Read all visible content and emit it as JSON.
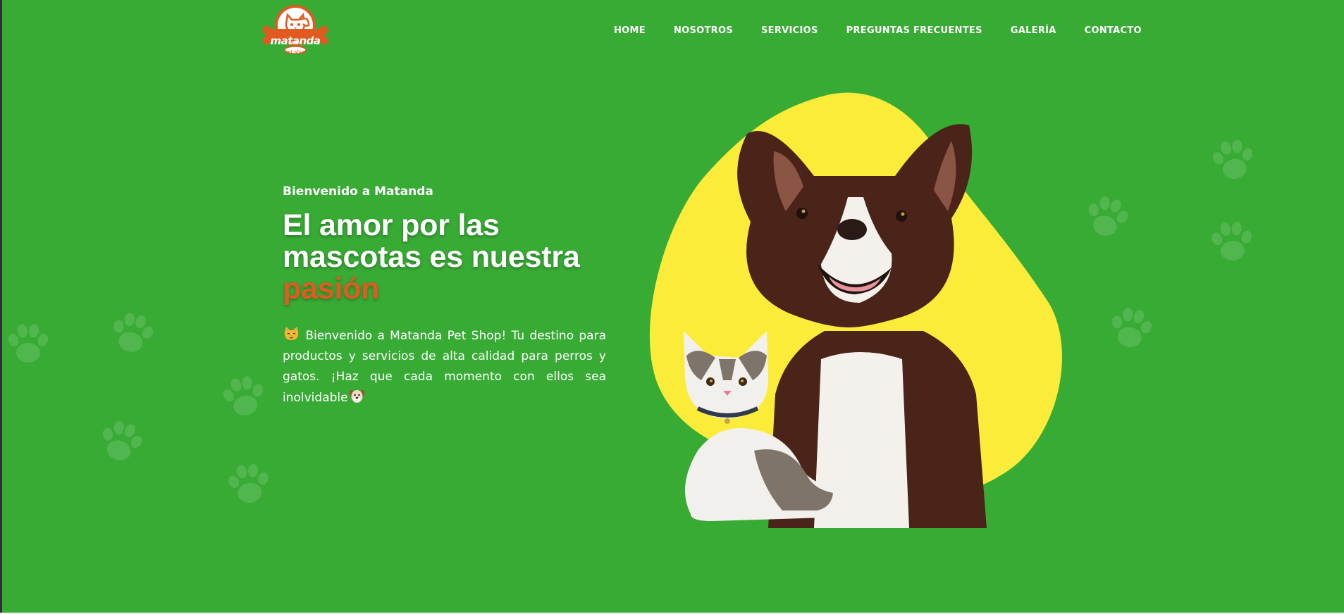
{
  "brand": {
    "name": "matanda",
    "tagline": "pet shop",
    "logo_icon": "cat-and-dog-bone-logo",
    "colors": {
      "background_green": "#38AB35",
      "accent_orange": "#E15A1F",
      "blob_yellow": "#FCEC3A",
      "text_white": "#FFFFFF"
    }
  },
  "nav": {
    "items": [
      {
        "label": "HOME"
      },
      {
        "label": "NOSOTROS"
      },
      {
        "label": "SERVICIOS"
      },
      {
        "label": "PREGUNTAS FRECUENTES"
      },
      {
        "label": "GALERÍA"
      },
      {
        "label": "CONTACTO"
      }
    ]
  },
  "hero": {
    "eyebrow": "Bienvenido a Matanda",
    "headline_main": "El amor por las mascotas es nuestra",
    "headline_accent": "pasión",
    "intro_text": "Bienvenido a Matanda Pet Shop! Tu destino para productos y servicios de alta calidad para perros y gatos. ¡Haz que cada momento con ellos sea inolvidable",
    "intro_start_icon": "cat-face-icon",
    "intro_end_icon": "dog-face-icon",
    "image": {
      "subjects": [
        "dog",
        "cat"
      ],
      "backdrop": "yellow-blob"
    }
  },
  "decorations": {
    "pattern_icon": "paw-print-icon"
  }
}
